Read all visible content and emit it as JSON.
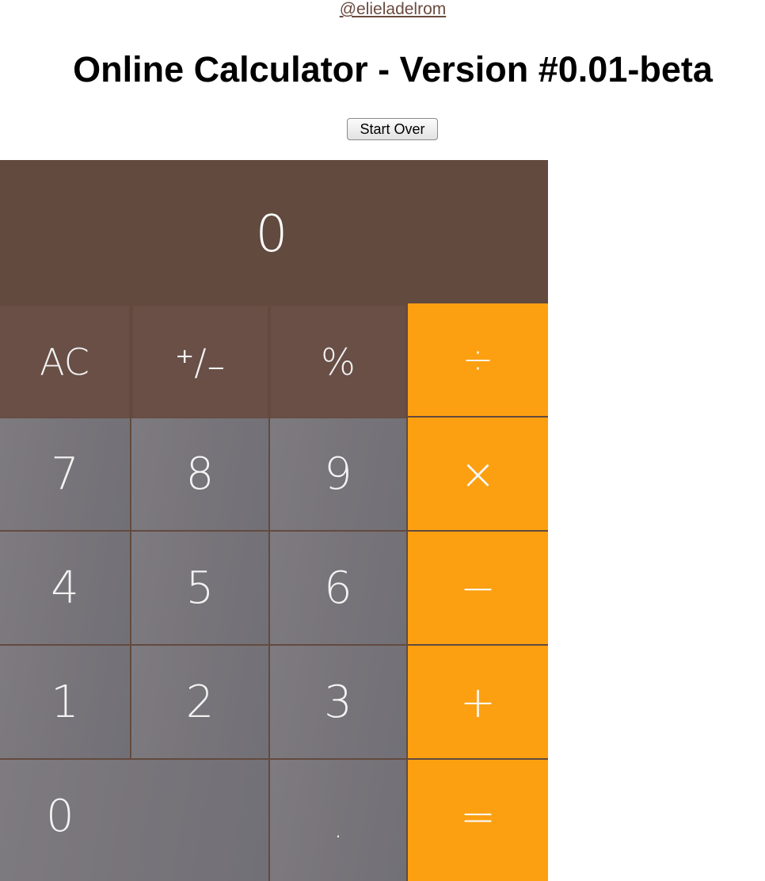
{
  "header": {
    "author": "@elieladelrom",
    "title": "Online Calculator - Version #0.01-beta",
    "start_over_label": "Start Over"
  },
  "calculator": {
    "display": "0",
    "keys": {
      "ac": "AC",
      "plus_minus": "⁺∕₋",
      "percent": "%",
      "divide": "÷",
      "seven": "7",
      "eight": "8",
      "nine": "9",
      "multiply": "×",
      "four": "4",
      "five": "5",
      "six": "6",
      "subtract": "−",
      "one": "1",
      "two": "2",
      "three": "3",
      "add": "+",
      "zero": "0",
      "decimal": ".",
      "equals": "="
    }
  },
  "colors": {
    "display_background": "#634a3f",
    "function_key": "#6a4f46",
    "number_key": "#7a777d",
    "operator_key": "#fca011",
    "key_text": "#f2f2f2"
  }
}
